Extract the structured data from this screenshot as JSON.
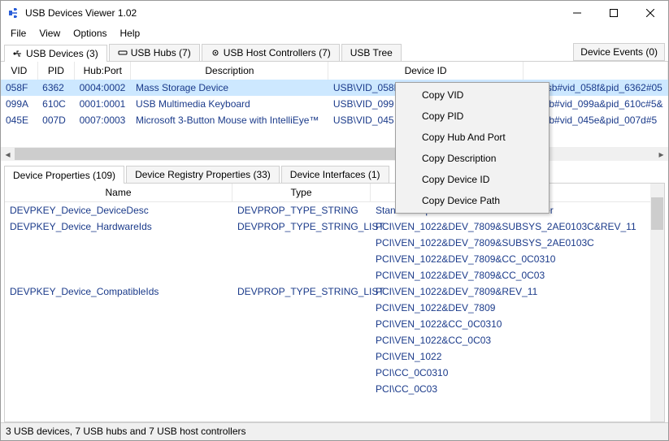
{
  "window": {
    "title": "USB Devices Viewer 1.02"
  },
  "menu": {
    "file": "File",
    "view": "View",
    "options": "Options",
    "help": "Help"
  },
  "tabs": {
    "usb_devices": "USB Devices (3)",
    "usb_hubs": "USB Hubs (7)",
    "usb_host_controllers": "USB Host Controllers (7)",
    "usb_tree": "USB Tree",
    "device_events": "Device Events (0)"
  },
  "top_table": {
    "headers": {
      "vid": "VID",
      "pid": "PID",
      "hub_port": "Hub:Port",
      "description": "Description",
      "device_id": "Device ID",
      "device_path": ""
    },
    "rows": [
      {
        "vid": "058F",
        "pid": "6362",
        "hub_port": "0004:0002",
        "description": "Mass Storage Device",
        "device_id": "USB\\VID_058F&PID_6362\\058F63626476",
        "device_path": "\\\\?\\usb#vid_058f&pid_6362#05"
      },
      {
        "vid": "099A",
        "pid": "610C",
        "hub_port": "0001:0001",
        "description": "USB Multimedia Keyboard",
        "device_id": "USB\\VID_099",
        "device_path": "\\?\\usb#vid_099a&pid_610c#5&"
      },
      {
        "vid": "045E",
        "pid": "007D",
        "hub_port": "0007:0003",
        "description": "Microsoft 3-Button Mouse with IntelliEye™",
        "device_id": "USB\\VID_045",
        "device_path": "\\?\\usb#vid_045e&pid_007d#5"
      }
    ]
  },
  "bottom_tabs": {
    "device_properties": "Device Properties (109)",
    "device_registry": "Device Registry Properties (33)",
    "device_interfaces": "Device Interfaces (1)"
  },
  "props_table": {
    "headers": {
      "name": "Name",
      "type": "Type",
      "value": ""
    },
    "rows": [
      {
        "name": "DEVPKEY_Device_DeviceDesc",
        "type": "DEVPROP_TYPE_STRING",
        "value": "Standard OpenHCD USB Host Controller"
      },
      {
        "name": "DEVPKEY_Device_HardwareIds",
        "type": "DEVPROP_TYPE_STRING_LIST",
        "value": "PCI\\VEN_1022&DEV_7809&SUBSYS_2AE0103C&REV_11"
      },
      {
        "name": "",
        "type": "",
        "value": "PCI\\VEN_1022&DEV_7809&SUBSYS_2AE0103C"
      },
      {
        "name": "",
        "type": "",
        "value": "PCI\\VEN_1022&DEV_7809&CC_0C0310"
      },
      {
        "name": "",
        "type": "",
        "value": "PCI\\VEN_1022&DEV_7809&CC_0C03"
      },
      {
        "name": "DEVPKEY_Device_CompatibleIds",
        "type": "DEVPROP_TYPE_STRING_LIST",
        "value": "PCI\\VEN_1022&DEV_7809&REV_11"
      },
      {
        "name": "",
        "type": "",
        "value": "PCI\\VEN_1022&DEV_7809"
      },
      {
        "name": "",
        "type": "",
        "value": "PCI\\VEN_1022&CC_0C0310"
      },
      {
        "name": "",
        "type": "",
        "value": "PCI\\VEN_1022&CC_0C03"
      },
      {
        "name": "",
        "type": "",
        "value": "PCI\\VEN_1022"
      },
      {
        "name": "",
        "type": "",
        "value": "PCI\\CC_0C0310"
      },
      {
        "name": "",
        "type": "",
        "value": "PCI\\CC_0C03"
      }
    ]
  },
  "context_menu": {
    "copy_vid": "Copy VID",
    "copy_pid": "Copy PID",
    "copy_hub_port": "Copy Hub And Port",
    "copy_description": "Copy Description",
    "copy_device_id": "Copy Device ID",
    "copy_device_path": "Copy Device Path"
  },
  "status": "3 USB devices, 7 USB hubs and 7 USB host controllers"
}
